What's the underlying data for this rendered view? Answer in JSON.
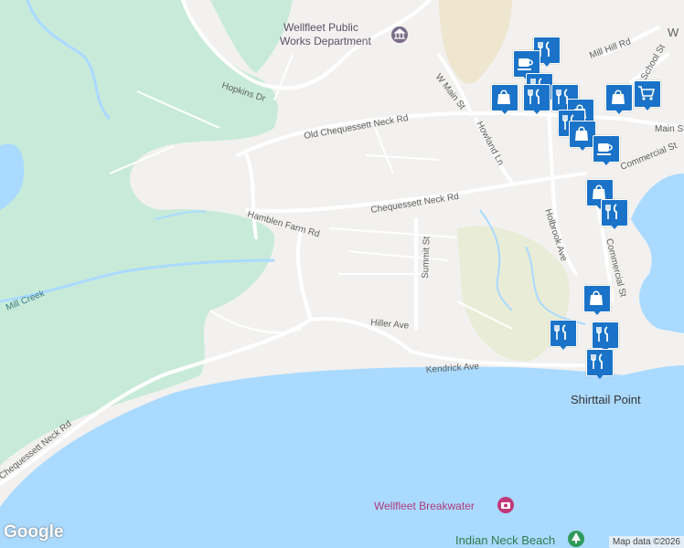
{
  "map": {
    "colors": {
      "water": "#aadaff",
      "park": "#c8ebd9",
      "land": "#f2f1ef",
      "road": "#ffffff",
      "road_stroke": "#d6d4d0",
      "marker": "#1a73c8"
    },
    "roads": [
      {
        "label": "Hopkins Dr"
      },
      {
        "label": "Old Chequessett Neck Rd"
      },
      {
        "label": "Hamblen Farm Rd"
      },
      {
        "label": "Chequessett Neck Rd"
      },
      {
        "label": "W Main St"
      },
      {
        "label": "Howland Ln"
      },
      {
        "label": "Summit St"
      },
      {
        "label": "Holbrook Ave"
      },
      {
        "label": "Commercial St"
      },
      {
        "label": "Hiller Ave"
      },
      {
        "label": "Kendrick Ave"
      },
      {
        "label": "Chequessett Neck Rd"
      },
      {
        "label": "Mill Hill Rd"
      },
      {
        "label": "School St"
      },
      {
        "label": "Main St"
      },
      {
        "label": "Commercial St"
      },
      {
        "label": "W"
      }
    ],
    "places": [
      {
        "label_line1": "Wellfleet Public",
        "label_line2": "Works Department",
        "icon": "landmark-icon"
      },
      {
        "label": "Shirttail Point"
      },
      {
        "label": "Wellfleet Breakwater",
        "icon": "camera-icon"
      },
      {
        "label": "Indian Neck Beach",
        "icon": "tree-icon"
      }
    ],
    "water_labels": [
      {
        "label": "Mill Creek"
      }
    ],
    "markers": [
      {
        "icon": "restaurant-icon"
      },
      {
        "icon": "coffee-icon"
      },
      {
        "icon": "restaurant-icon"
      },
      {
        "icon": "shopping-bag-icon"
      },
      {
        "icon": "restaurant-icon"
      },
      {
        "icon": "shopping-bag-icon"
      },
      {
        "icon": "shopping-cart-icon"
      },
      {
        "icon": "restaurant-icon"
      },
      {
        "icon": "shopping-bag-icon"
      },
      {
        "icon": "restaurant-icon"
      },
      {
        "icon": "shopping-bag-icon"
      },
      {
        "icon": "coffee-icon"
      },
      {
        "icon": "shopping-bag-icon"
      },
      {
        "icon": "restaurant-icon"
      },
      {
        "icon": "shopping-bag-icon"
      },
      {
        "icon": "restaurant-icon"
      },
      {
        "icon": "restaurant-icon"
      },
      {
        "icon": "restaurant-icon"
      }
    ]
  },
  "footer": {
    "logo": "Google",
    "attribution": "Map data ©2026"
  }
}
